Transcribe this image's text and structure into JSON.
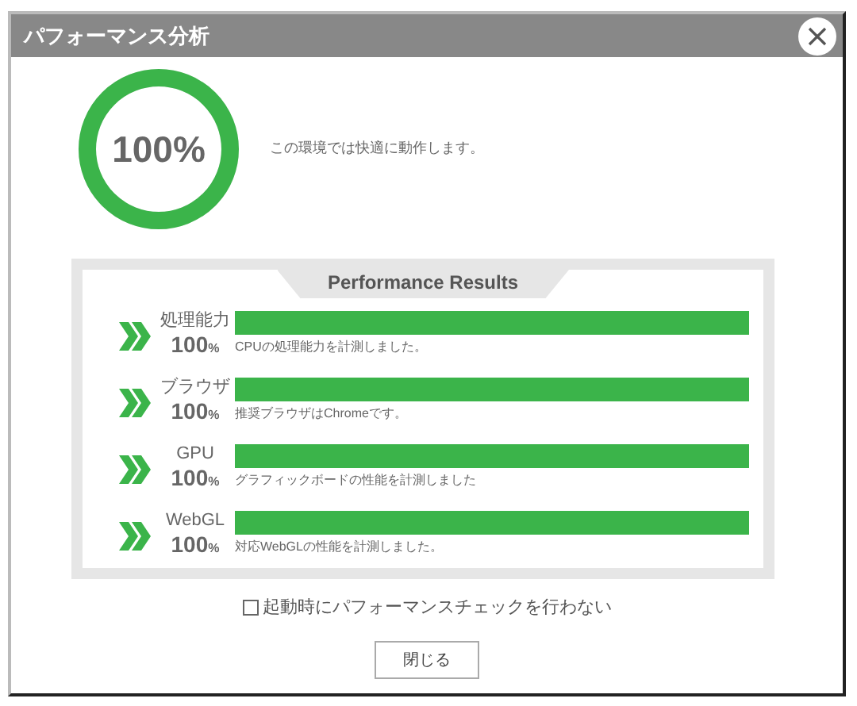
{
  "window": {
    "title": "パフォーマンス分析"
  },
  "summary": {
    "score": "100%",
    "level": 1,
    "message": "この環境では快適に動作します。"
  },
  "results": {
    "title": "Performance Results",
    "items": [
      {
        "name": "処理能力",
        "percent": "100",
        "unit": "%",
        "level": 1,
        "note": "CPUの処理能力を計測しました。"
      },
      {
        "name": "ブラウザ",
        "percent": "100",
        "unit": "%",
        "level": 1,
        "note": "推奨ブラウザはChromeです。"
      },
      {
        "name": "GPU",
        "percent": "100",
        "unit": "%",
        "level": 1,
        "note": "グラフィックボードの性能を計測しました"
      },
      {
        "name": "WebGL",
        "percent": "100",
        "unit": "%",
        "level": 1,
        "note": "対応WebGLの性能を計測しました。"
      }
    ]
  },
  "option": {
    "label": "起動時にパフォーマンスチェックを行わない",
    "checked": false
  },
  "buttons": [
    "閉じる"
  ]
}
